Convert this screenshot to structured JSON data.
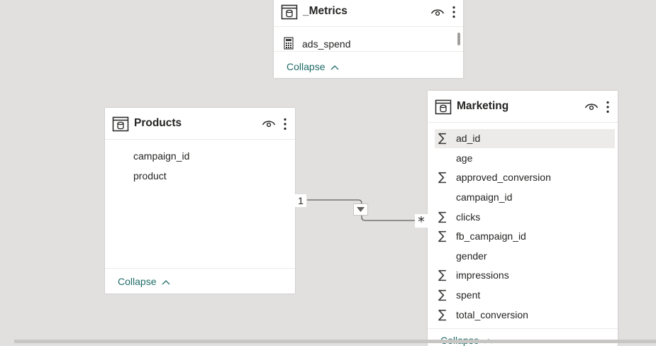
{
  "tables": {
    "metrics": {
      "title": "_Metrics",
      "fields": [
        {
          "label": "ads_spend",
          "icon": "calculator-icon"
        }
      ],
      "collapse_label": "Collapse"
    },
    "products": {
      "title": "Products",
      "fields": [
        {
          "label": "campaign_id"
        },
        {
          "label": "product"
        }
      ],
      "collapse_label": "Collapse"
    },
    "marketing": {
      "title": "Marketing",
      "fields": [
        {
          "label": "ad_id",
          "sigma": true
        },
        {
          "label": "age",
          "sigma": false
        },
        {
          "label": "approved_conversion",
          "sigma": true
        },
        {
          "label": "campaign_id",
          "sigma": false
        },
        {
          "label": "clicks",
          "sigma": true
        },
        {
          "label": "fb_campaign_id",
          "sigma": true
        },
        {
          "label": "gender",
          "sigma": false
        },
        {
          "label": "impressions",
          "sigma": true
        },
        {
          "label": "spent",
          "sigma": true
        },
        {
          "label": "total_conversion",
          "sigma": true
        }
      ],
      "collapse_label": "Collapse"
    }
  },
  "relationship": {
    "from_cardinality": "1",
    "to_cardinality": "*"
  },
  "sigma_symbol": "∑",
  "chevron_up": "^",
  "colors": {
    "canvas": "#e1e0df",
    "card": "#ffffff",
    "accent_link": "#1e6b67",
    "selected_row": "#edebe9"
  }
}
